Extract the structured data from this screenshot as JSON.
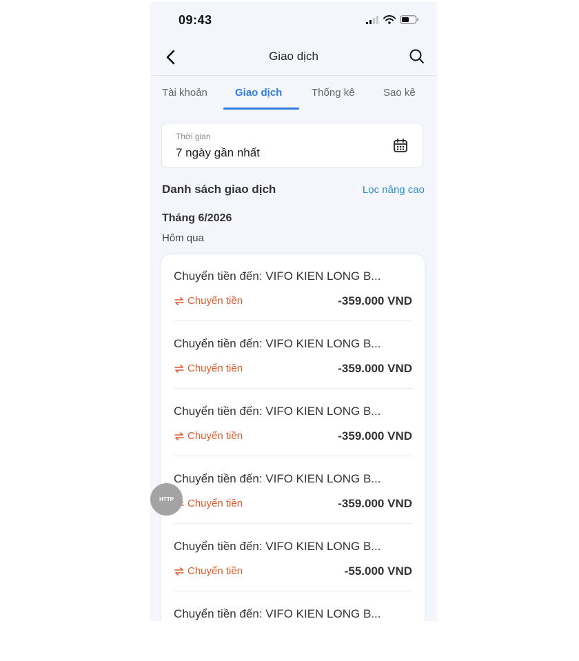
{
  "status_bar": {
    "time": "09:43"
  },
  "header": {
    "title": "Giao dịch"
  },
  "tabs": [
    {
      "label": "Tài khoản",
      "active": false
    },
    {
      "label": "Giao dịch",
      "active": true
    },
    {
      "label": "Thống kê",
      "active": false
    },
    {
      "label": "Sao kê",
      "active": false
    }
  ],
  "date_filter": {
    "label": "Thời gian",
    "value": "7 ngày gần nhất"
  },
  "list": {
    "title": "Danh sách giao dịch",
    "advanced_filter": "Lọc nâng cao",
    "month": "Tháng 6/2026",
    "day": "Hôm qua"
  },
  "transactions": [
    {
      "title": "Chuyển tiền đến: VIFO KIEN LONG B...",
      "type": "Chuyển tiền",
      "amount": "-359.000 VND"
    },
    {
      "title": "Chuyển tiền đến: VIFO KIEN LONG B...",
      "type": "Chuyển tiền",
      "amount": "-359.000 VND"
    },
    {
      "title": "Chuyển tiền đến: VIFO KIEN LONG B...",
      "type": "Chuyển tiền",
      "amount": "-359.000 VND"
    },
    {
      "title": "Chuyển tiền đến: VIFO KIEN LONG B...",
      "type": "Chuyển tiền",
      "amount": "-359.000 VND"
    },
    {
      "title": "Chuyển tiền đến: VIFO KIEN LONG B...",
      "type": "Chuyển tiền",
      "amount": "-55.000 VND"
    },
    {
      "title": "Chuyển tiền đến: VIFO KIEN LONG B...",
      "type": "",
      "amount": ""
    }
  ],
  "debug_badge": {
    "label": "HTTP"
  },
  "colors": {
    "accent": "#2f7de0",
    "transfer": "#e05a2a",
    "link": "#2a8fc7"
  },
  "icons": {
    "back": "chevron-left-icon",
    "search": "search-icon",
    "calendar": "calendar-icon",
    "transfer": "transfer-arrows-icon"
  }
}
